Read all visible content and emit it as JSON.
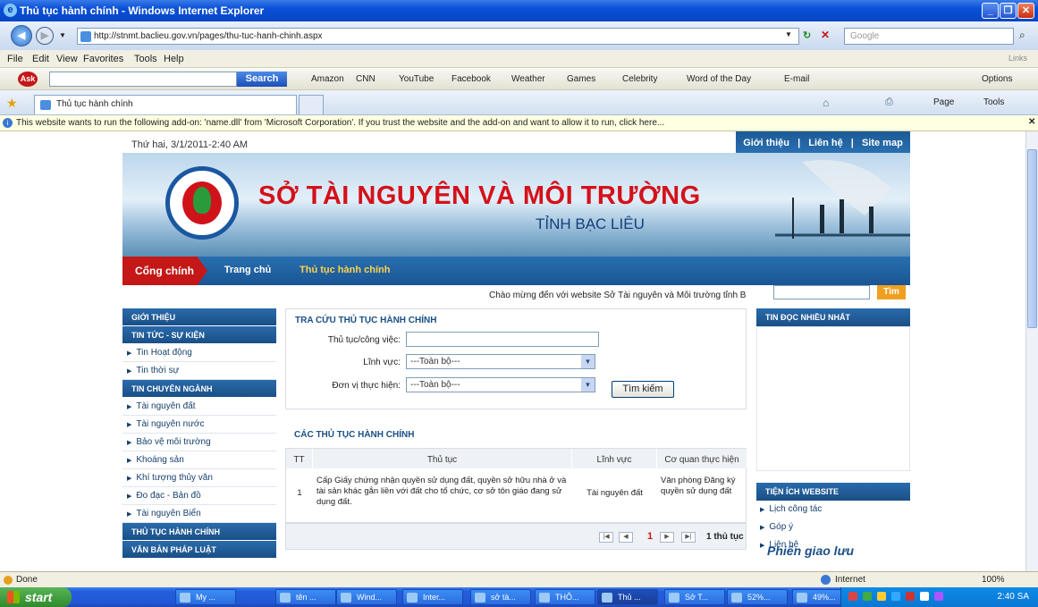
{
  "window": {
    "title": "Thủ tục hành chính - Windows Internet Explorer"
  },
  "address": {
    "url": "http://stnmt.baclieu.gov.vn/pages/thu-tuc-hanh-chinh.aspx",
    "search_placeholder": "Google"
  },
  "menu": [
    "File",
    "Edit",
    "View",
    "Favorites",
    "Tools",
    "Help"
  ],
  "menu_right": "Links",
  "toolbar": {
    "search_button": "Search",
    "links": [
      "Amazon",
      "CNN",
      "YouTube",
      "Facebook",
      "Weather",
      "Games",
      "Celebrity",
      "Word of the Day",
      "E-mail"
    ],
    "options": "Options"
  },
  "tabs": {
    "active": "Thủ tục hành chính",
    "page_menu": "Page",
    "tools_menu": "Tools"
  },
  "infobar": "This website wants to run the following add-on: 'name.dll' from 'Microsoft Corporation'. If you trust the website and the add-on and want to allow it to run, click here...",
  "site": {
    "date": "Thứ hai, 3/1/2011-2:40 AM",
    "top_links": [
      "Giới thiệu",
      "Liên hệ",
      "Site map"
    ],
    "banner_title": "SỞ TÀI NGUYÊN VÀ MÔI TRƯỜNG",
    "banner_sub": "TỈNH BẠC LIÊU",
    "nav": {
      "home": "Cổng chính",
      "main": "Trang chủ",
      "current": "Thủ tục hành chính"
    },
    "welcome": "Chào mừng đến với website Sở Tài nguyên và Môi trường tỉnh B",
    "search_button": "Tìm",
    "left_menu": [
      {
        "type": "h",
        "label": "GIỚI THIỆU"
      },
      {
        "type": "h",
        "label": "TIN TỨC - SỰ KIỆN"
      },
      {
        "type": "i",
        "label": "Tin Hoạt động"
      },
      {
        "type": "i",
        "label": "Tin thời sự"
      },
      {
        "type": "h",
        "label": "TIN CHUYÊN NGÀNH"
      },
      {
        "type": "i",
        "label": "Tài nguyên đất"
      },
      {
        "type": "i",
        "label": "Tài nguyên nước"
      },
      {
        "type": "i",
        "label": "Bảo vệ môi trường"
      },
      {
        "type": "i",
        "label": "Khoáng sản"
      },
      {
        "type": "i",
        "label": "Khí tượng thủy văn"
      },
      {
        "type": "i",
        "label": "Đo đạc - Bản đồ"
      },
      {
        "type": "i",
        "label": "Tài nguyên Biển"
      },
      {
        "type": "h",
        "label": "THỦ TỤC HÀNH CHÍNH"
      },
      {
        "type": "h",
        "label": "VĂN BẢN PHÁP LUẬT"
      }
    ],
    "search_panel": {
      "title": "TRA CỨU THỦ TỤC HÀNH CHÍNH",
      "label_proc": "Thủ tục/công việc:",
      "label_field": "Lĩnh vực:",
      "label_unit": "Đơn vị thực hiện:",
      "field_value": "---Toàn bộ---",
      "unit_value": "---Toàn bộ---",
      "button": "Tìm kiếm"
    },
    "list_title": "CÁC THỦ TỤC HÀNH CHÍNH",
    "table": {
      "headers": [
        "TT",
        "Thủ tục",
        "Lĩnh vực",
        "Cơ quan thực hiện"
      ],
      "rows": [
        [
          "1",
          "Cấp Giấy chứng nhận quyền sử dụng đất, quyền sở hữu nhà ở và tài sản khác gắn liền với đất cho tổ chức, cơ sở tôn giáo đang sử dụng đất.",
          "Tài nguyên đất",
          "Văn phòng Đăng ký quyền sử dụng đất"
        ]
      ]
    },
    "pager": {
      "current": "1",
      "summary": "1 thủ tục"
    },
    "right": {
      "popular_title": "TIN ĐỌC NHIỀU NHẤT",
      "utility_title": "TIỆN ÍCH WEBSITE",
      "utility_items": [
        "Lịch công tác",
        "Góp ý",
        "Liên hệ"
      ],
      "phien": "Phiên giao lưu"
    }
  },
  "status": {
    "left": "Done",
    "zone": "Internet",
    "zoom": "100%"
  },
  "taskbar": {
    "start": "start",
    "tasks": [
      "My ...",
      "tên ...",
      "Wind...",
      "Inter...",
      "sở tà...",
      "THÔ...",
      "Thủ ...",
      "Sở T...",
      "52%...",
      "49%..."
    ],
    "clock": "2:40 SA"
  }
}
